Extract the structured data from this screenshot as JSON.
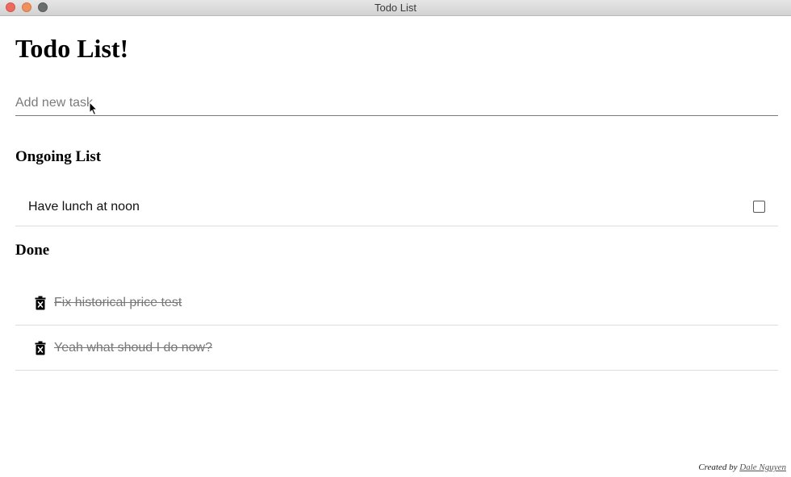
{
  "window": {
    "title": "Todo List"
  },
  "header": {
    "title": "Todo List!"
  },
  "new_task": {
    "value": "",
    "placeholder": "Add new task"
  },
  "ongoing": {
    "title": "Ongoing List",
    "items": [
      {
        "text": "Have lunch at noon",
        "checked": false
      }
    ]
  },
  "done": {
    "title": "Done",
    "items": [
      {
        "text": "Fix historical price test",
        "icon": "trash-icon"
      },
      {
        "text": "Yeah what shoud I do now?",
        "icon": "trash-icon"
      }
    ]
  },
  "footer": {
    "prefix": "Created by",
    "author": "Dale Nguyen"
  },
  "colors": {
    "close": "#ee6a5e",
    "minimize": "#f0905a",
    "zoom": "#6a6e6c"
  }
}
